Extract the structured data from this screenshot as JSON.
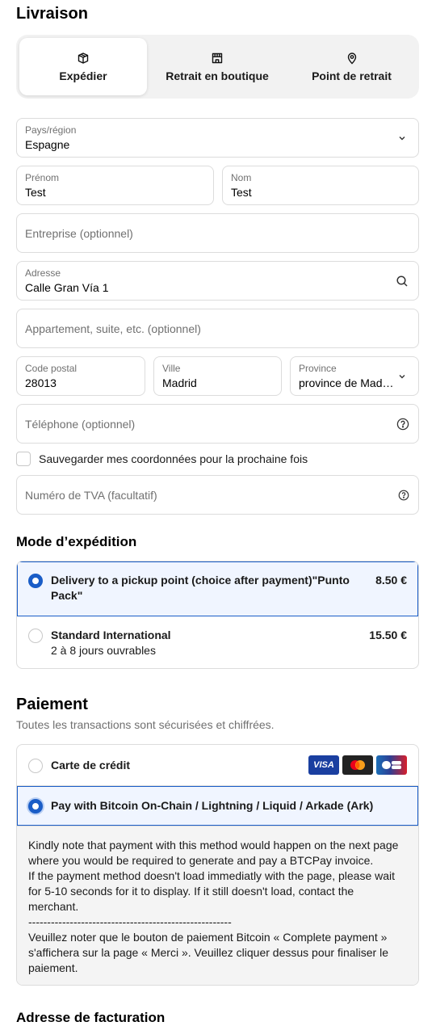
{
  "delivery": {
    "heading": "Livraison",
    "tabs": [
      {
        "label": "Expédier",
        "icon": "box-icon",
        "active": true
      },
      {
        "label": "Retrait en boutique",
        "icon": "store-icon",
        "active": false
      },
      {
        "label": "Point de retrait",
        "icon": "location-pin-icon",
        "active": false
      }
    ]
  },
  "form": {
    "country": {
      "label": "Pays/région",
      "value": "Espagne"
    },
    "first_name": {
      "label": "Prénom",
      "value": "Test"
    },
    "last_name": {
      "label": "Nom",
      "value": "Test"
    },
    "company": {
      "placeholder": "Entreprise (optionnel)"
    },
    "address": {
      "label": "Adresse",
      "value": "Calle Gran Vía 1"
    },
    "apartment": {
      "placeholder": "Appartement, suite, etc. (optionnel)"
    },
    "postal_code": {
      "label": "Code postal",
      "value": "28013"
    },
    "city": {
      "label": "Ville",
      "value": "Madrid"
    },
    "province": {
      "label": "Province",
      "value": "province de Mad…"
    },
    "phone": {
      "placeholder": "Téléphone (optionnel)"
    },
    "save_info": {
      "label": "Sauvegarder mes coordonnées pour la prochaine fois",
      "checked": false
    },
    "vat": {
      "placeholder": "Numéro de TVA (facultatif)"
    }
  },
  "shipping": {
    "heading": "Mode d’expédition",
    "options": [
      {
        "title_line1": "Delivery to a pickup point (choice after payment)\"Punto",
        "title_line2": "Pack\"",
        "price": "8.50 €",
        "selected": true
      },
      {
        "title": "Standard International",
        "subtitle": "2 à 8 jours ouvrables",
        "price": "15.50 €",
        "selected": false
      }
    ]
  },
  "payment": {
    "heading": "Paiement",
    "subtitle": "Toutes les transactions sont sécurisées et chiffrées.",
    "options": [
      {
        "title": "Carte de crédit",
        "selected": false,
        "cards": [
          "VISA",
          "mastercard",
          "CB"
        ]
      },
      {
        "title": "Pay with Bitcoin On-Chain / Lightning / Liquid / Arkade (Ark)",
        "selected": true
      }
    ],
    "info": [
      "Kindly note that payment with this method would happen on the next page where you would be required to generate and pay a BTCPay invoice.",
      "If the payment method doesn't load immediatly with the page, please wait for 5-10 seconds for it to display. If it still doesn't load, contact the merchant.",
      "--------------------------------------------------------",
      "Veuillez noter que le bouton de paiement Bitcoin « Complete payment » s'affichera sur la page « Merci ». Veuillez cliquer dessus pour finaliser le paiement."
    ]
  },
  "billing": {
    "heading": "Adresse de facturation"
  },
  "colors": {
    "accent": "#1a5dc7",
    "border": "#dcdcdc",
    "muted": "#707070",
    "selected_bg": "#f0f5ff"
  }
}
